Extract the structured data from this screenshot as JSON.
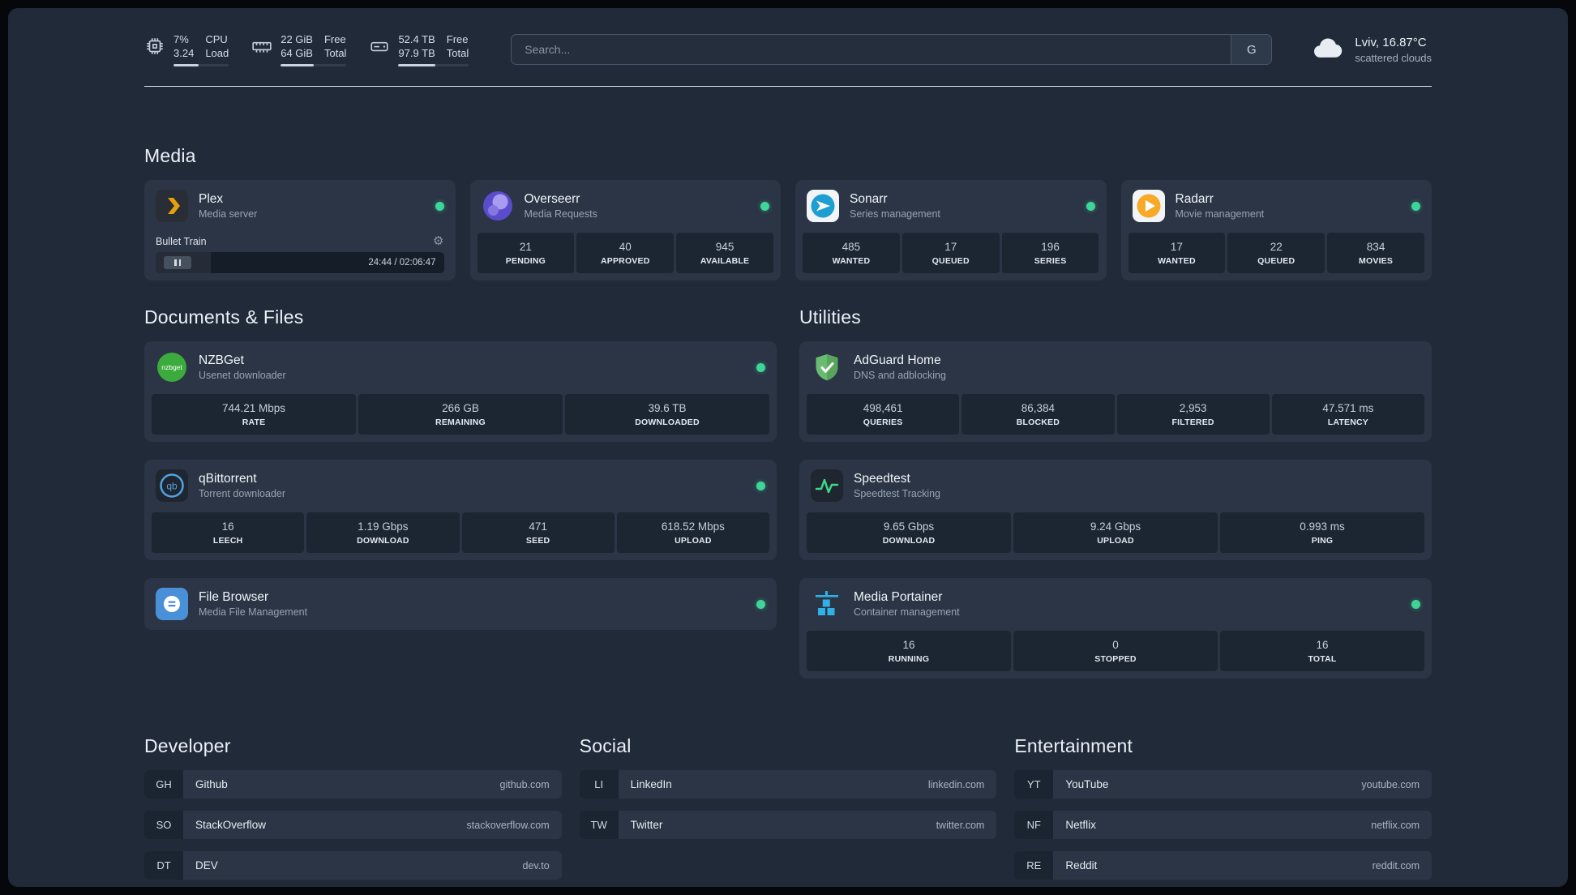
{
  "colors": {
    "status_online": "#3ed598",
    "background": "#202a39",
    "card": "#2b3545",
    "tile": "#1c2532"
  },
  "topbar": {
    "widgets": [
      {
        "icon": "cpu-icon",
        "values": [
          "7%",
          "3.24"
        ],
        "labels": [
          "CPU",
          "Load"
        ],
        "bar_pct": 45
      },
      {
        "icon": "memory-icon",
        "values": [
          "22 GiB",
          "64 GiB"
        ],
        "labels": [
          "Free",
          "Total"
        ],
        "bar_pct": 50
      },
      {
        "icon": "disk-icon",
        "values": [
          "52.4 TB",
          "97.9 TB"
        ],
        "labels": [
          "Free",
          "Total"
        ],
        "bar_pct": 52
      }
    ],
    "search": {
      "placeholder": "Search...",
      "button_label": "G"
    },
    "weather": {
      "icon": "cloud-icon",
      "location": "Lviv, 16.87°C",
      "condition": "scattered clouds"
    }
  },
  "media": {
    "title": "Media",
    "plex": {
      "icon": "plex-icon",
      "name": "Plex",
      "description": "Media server",
      "online": true,
      "player": {
        "track": "Bullet Train",
        "time": "24:44 / 02:06:47",
        "progress_pct": 19
      }
    },
    "overseerr": {
      "icon": "overseerr-icon",
      "name": "Overseerr",
      "description": "Media Requests",
      "online": true,
      "stats": [
        {
          "value": "21",
          "label": "PENDING"
        },
        {
          "value": "40",
          "label": "APPROVED"
        },
        {
          "value": "945",
          "label": "AVAILABLE"
        }
      ]
    },
    "sonarr": {
      "icon": "sonarr-icon",
      "name": "Sonarr",
      "description": "Series management",
      "online": true,
      "stats": [
        {
          "value": "485",
          "label": "WANTED"
        },
        {
          "value": "17",
          "label": "QUEUED"
        },
        {
          "value": "196",
          "label": "SERIES"
        }
      ]
    },
    "radarr": {
      "icon": "radarr-icon",
      "name": "Radarr",
      "description": "Movie management",
      "online": true,
      "stats": [
        {
          "value": "17",
          "label": "WANTED"
        },
        {
          "value": "22",
          "label": "QUEUED"
        },
        {
          "value": "834",
          "label": "MOVIES"
        }
      ]
    }
  },
  "documents": {
    "title": "Documents & Files",
    "nzbget": {
      "icon": "nzbget-icon",
      "name": "NZBGet",
      "description": "Usenet downloader",
      "online": true,
      "stats": [
        {
          "value": "744.21 Mbps",
          "label": "RATE"
        },
        {
          "value": "266 GB",
          "label": "REMAINING"
        },
        {
          "value": "39.6 TB",
          "label": "DOWNLOADED"
        }
      ]
    },
    "qbittorrent": {
      "icon": "qbittorrent-icon",
      "name": "qBittorrent",
      "description": "Torrent downloader",
      "online": true,
      "stats": [
        {
          "value": "16",
          "label": "LEECH"
        },
        {
          "value": "1.19 Gbps",
          "label": "DOWNLOAD"
        },
        {
          "value": "471",
          "label": "SEED"
        },
        {
          "value": "618.52 Mbps",
          "label": "UPLOAD"
        }
      ]
    },
    "filebrowser": {
      "icon": "filebrowser-icon",
      "name": "File Browser",
      "description": "Media File Management",
      "online": true
    }
  },
  "utilities": {
    "title": "Utilities",
    "adguard": {
      "icon": "adguard-icon",
      "name": "AdGuard Home",
      "description": "DNS and adblocking",
      "online": false,
      "stats": [
        {
          "value": "498,461",
          "label": "QUERIES"
        },
        {
          "value": "86,384",
          "label": "BLOCKED"
        },
        {
          "value": "2,953",
          "label": "FILTERED"
        },
        {
          "value": "47.571 ms",
          "label": "LATENCY"
        }
      ]
    },
    "speedtest": {
      "icon": "speedtest-icon",
      "name": "Speedtest",
      "description": "Speedtest Tracking",
      "online": false,
      "stats": [
        {
          "value": "9.65 Gbps",
          "label": "DOWNLOAD"
        },
        {
          "value": "9.24 Gbps",
          "label": "UPLOAD"
        },
        {
          "value": "0.993 ms",
          "label": "PING"
        }
      ]
    },
    "portainer": {
      "icon": "portainer-icon",
      "name": "Media Portainer",
      "description": "Container management",
      "online": true,
      "stats": [
        {
          "value": "16",
          "label": "RUNNING"
        },
        {
          "value": "0",
          "label": "STOPPED"
        },
        {
          "value": "16",
          "label": "TOTAL"
        }
      ]
    }
  },
  "bookmarks": {
    "developer": {
      "title": "Developer",
      "items": [
        {
          "abbr": "GH",
          "name": "Github",
          "domain": "github.com"
        },
        {
          "abbr": "SO",
          "name": "StackOverflow",
          "domain": "stackoverflow.com"
        },
        {
          "abbr": "DT",
          "name": "DEV",
          "domain": "dev.to"
        }
      ]
    },
    "social": {
      "title": "Social",
      "items": [
        {
          "abbr": "LI",
          "name": "LinkedIn",
          "domain": "linkedin.com"
        },
        {
          "abbr": "TW",
          "name": "Twitter",
          "domain": "twitter.com"
        }
      ]
    },
    "entertainment": {
      "title": "Entertainment",
      "items": [
        {
          "abbr": "YT",
          "name": "YouTube",
          "domain": "youtube.com"
        },
        {
          "abbr": "NF",
          "name": "Netflix",
          "domain": "netflix.com"
        },
        {
          "abbr": "RE",
          "name": "Reddit",
          "domain": "reddit.com"
        }
      ]
    }
  }
}
